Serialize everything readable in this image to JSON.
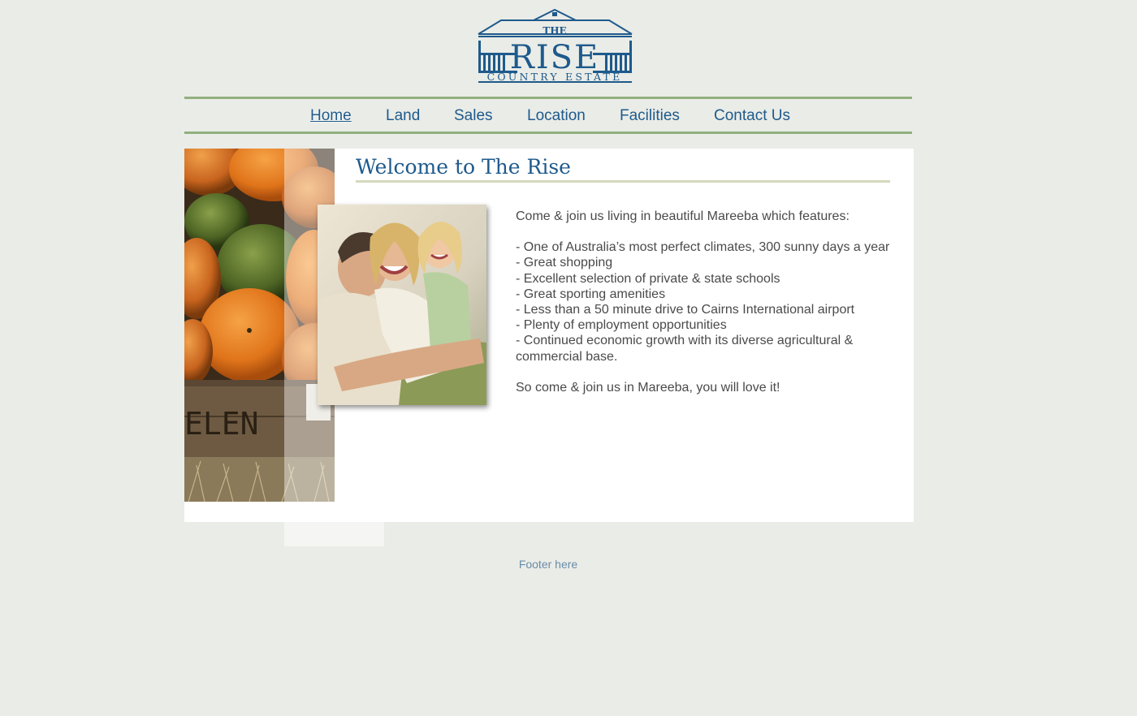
{
  "logo": {
    "top_text": "THE",
    "main_text": "RISE",
    "sub_text": "COUNTRY ESTATE",
    "color": "#1e5a8c"
  },
  "nav": {
    "items": [
      {
        "label": "Home",
        "active": true
      },
      {
        "label": "Land"
      },
      {
        "label": "Sales"
      },
      {
        "label": "Location"
      },
      {
        "label": "Facilities"
      },
      {
        "label": "Contact Us"
      }
    ],
    "border_color": "#92b07e"
  },
  "main": {
    "title": "Welcome to The Rise",
    "intro": "Come & join us living in beautiful Mareeba which features:",
    "features": [
      "- One of Australia’s most perfect climates, 300 sunny days a year",
      "- Great shopping",
      "- Excellent selection of private & state schools",
      "- Great sporting amenities",
      "- Less than a 50 minute drive to Cairns International airport",
      "- Plenty of employment opportunities",
      "- Continued economic growth with its diverse agricultural & commercial base."
    ],
    "closing": "So come & join us in Mareeba, you will love it!",
    "side_image_crate_text": "ELEN"
  },
  "footer": {
    "text": "Footer here"
  },
  "colors": {
    "background": "#eaece7",
    "panel": "#ffffff",
    "heading": "#1e5a8c",
    "body_text": "#4a4a4a"
  }
}
